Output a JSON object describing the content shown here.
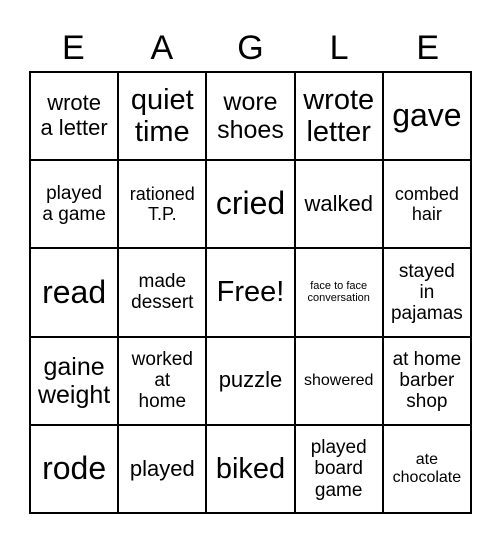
{
  "title_letters": [
    "E",
    "A",
    "G",
    "L",
    "E"
  ],
  "cells": [
    {
      "text": "wrote\na letter",
      "size": "s-m"
    },
    {
      "text": "quiet\ntime",
      "size": "s-l"
    },
    {
      "text": "wore\nshoes",
      "size": "s-ml"
    },
    {
      "text": "wrote\nletter",
      "size": "s-l"
    },
    {
      "text": "gave",
      "size": "s-xl"
    },
    {
      "text": "played\na game",
      "size": "s-sm"
    },
    {
      "text": "rationed\nT.P.",
      "size": "s-s"
    },
    {
      "text": "cried",
      "size": "s-xl"
    },
    {
      "text": "walked",
      "size": "s-m"
    },
    {
      "text": "combed\nhair",
      "size": "s-s"
    },
    {
      "text": "read",
      "size": "s-xl"
    },
    {
      "text": "made\ndessert",
      "size": "s-sm"
    },
    {
      "text": "Free!",
      "size": "s-l"
    },
    {
      "text": "face to face\nconversation",
      "size": "s-xxs"
    },
    {
      "text": "stayed\nin\npajamas",
      "size": "s-sm"
    },
    {
      "text": "gaine\nweight",
      "size": "s-ml"
    },
    {
      "text": "worked\nat\nhome",
      "size": "s-sm"
    },
    {
      "text": "puzzle",
      "size": "s-m"
    },
    {
      "text": "showered",
      "size": "s-xs"
    },
    {
      "text": "at home\nbarber\nshop",
      "size": "s-sm"
    },
    {
      "text": "rode",
      "size": "s-xl"
    },
    {
      "text": "played",
      "size": "s-m"
    },
    {
      "text": "biked",
      "size": "s-l"
    },
    {
      "text": "played\nboard\ngame",
      "size": "s-sm"
    },
    {
      "text": "ate\nchocolate",
      "size": "s-xs"
    }
  ]
}
